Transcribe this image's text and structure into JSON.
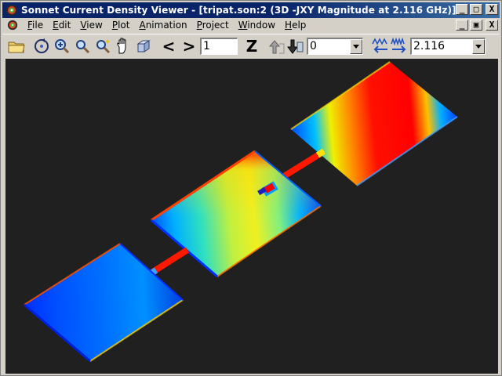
{
  "window": {
    "title": "Sonnet Current Density Viewer - [tripat.son:2 (3D -JXY Magnitude at 2.116 GHz)]",
    "buttons": {
      "minimize": "_",
      "maximize": "□",
      "close": "X"
    }
  },
  "menu": {
    "items": [
      {
        "u": "F",
        "rest": "ile"
      },
      {
        "u": "E",
        "rest": "dit"
      },
      {
        "u": "V",
        "rest": "iew"
      },
      {
        "u": "P",
        "rest": "lot"
      },
      {
        "u": "A",
        "rest": "nimation"
      },
      {
        "u": "P",
        "rest": "roject"
      },
      {
        "u": "W",
        "rest": "indow"
      },
      {
        "u": "H",
        "rest": "elp"
      }
    ],
    "mdi_buttons": {
      "minimize": "_",
      "restore": "▣",
      "close": "X"
    }
  },
  "toolbar": {
    "prev_label": "<",
    "next_label": ">",
    "level_value": "1",
    "z_label": "Z",
    "level_combo": "0",
    "frequency_combo": "2.116"
  },
  "colors": {
    "titlebar": "#0a246a",
    "viewport_bg": "#202020",
    "high": "#ff0000",
    "low": "#0000ff"
  }
}
